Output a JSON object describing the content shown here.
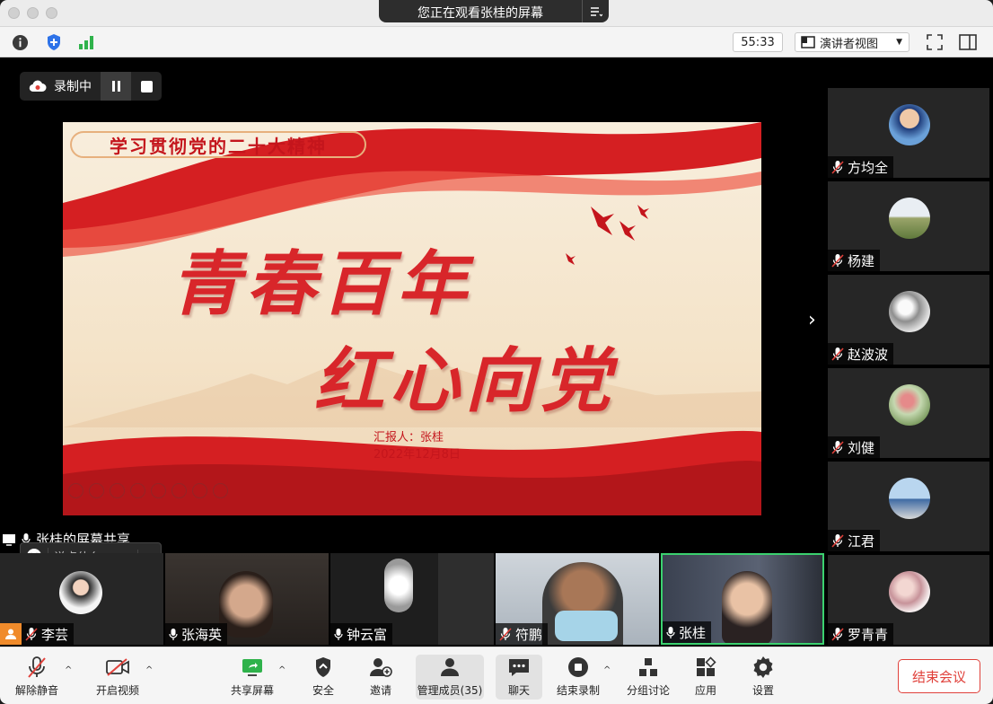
{
  "titlebar": {
    "sharing_title": "您正在观看张桂的屏幕"
  },
  "topbar": {
    "timer": "55:33",
    "view_mode": "演讲者视图"
  },
  "recording": {
    "label": "录制中"
  },
  "slide": {
    "topic": "学习贯彻党的二十大精神",
    "line1": "青春百年",
    "line2": "红心向党",
    "reporter": "汇报人：张桂",
    "date": "2022年12月8日"
  },
  "screen_share_label": "张桂的屏幕共享",
  "chat": {
    "placeholder": "说点什么..."
  },
  "right_participants": [
    {
      "name": "方均全",
      "muted": true
    },
    {
      "name": "杨建",
      "muted": true
    },
    {
      "name": "赵波波",
      "muted": true
    },
    {
      "name": "刘健",
      "muted": true
    },
    {
      "name": "江君",
      "muted": true
    },
    {
      "name": "罗青青",
      "muted": true
    }
  ],
  "bottom_participants": [
    {
      "name": "李芸",
      "muted": true
    },
    {
      "name": "张海英",
      "muted": false
    },
    {
      "name": "钟云富",
      "muted": false
    },
    {
      "name": "符鹏",
      "muted": true
    },
    {
      "name": "张桂",
      "muted": false
    }
  ],
  "toolbar": {
    "unmute": "解除静音",
    "start_video": "开启视频",
    "share_screen": "共享屏幕",
    "security": "安全",
    "invite": "邀请",
    "participants": "管理成员(35)",
    "chat": "聊天",
    "end_recording": "结束录制",
    "breakout": "分组讨论",
    "apps": "应用",
    "settings": "设置",
    "end_meeting": "结束会议"
  },
  "colors": {
    "accent_red": "#e0413b",
    "active_speaker": "#3bd16f",
    "slide_red": "#d8262a"
  }
}
